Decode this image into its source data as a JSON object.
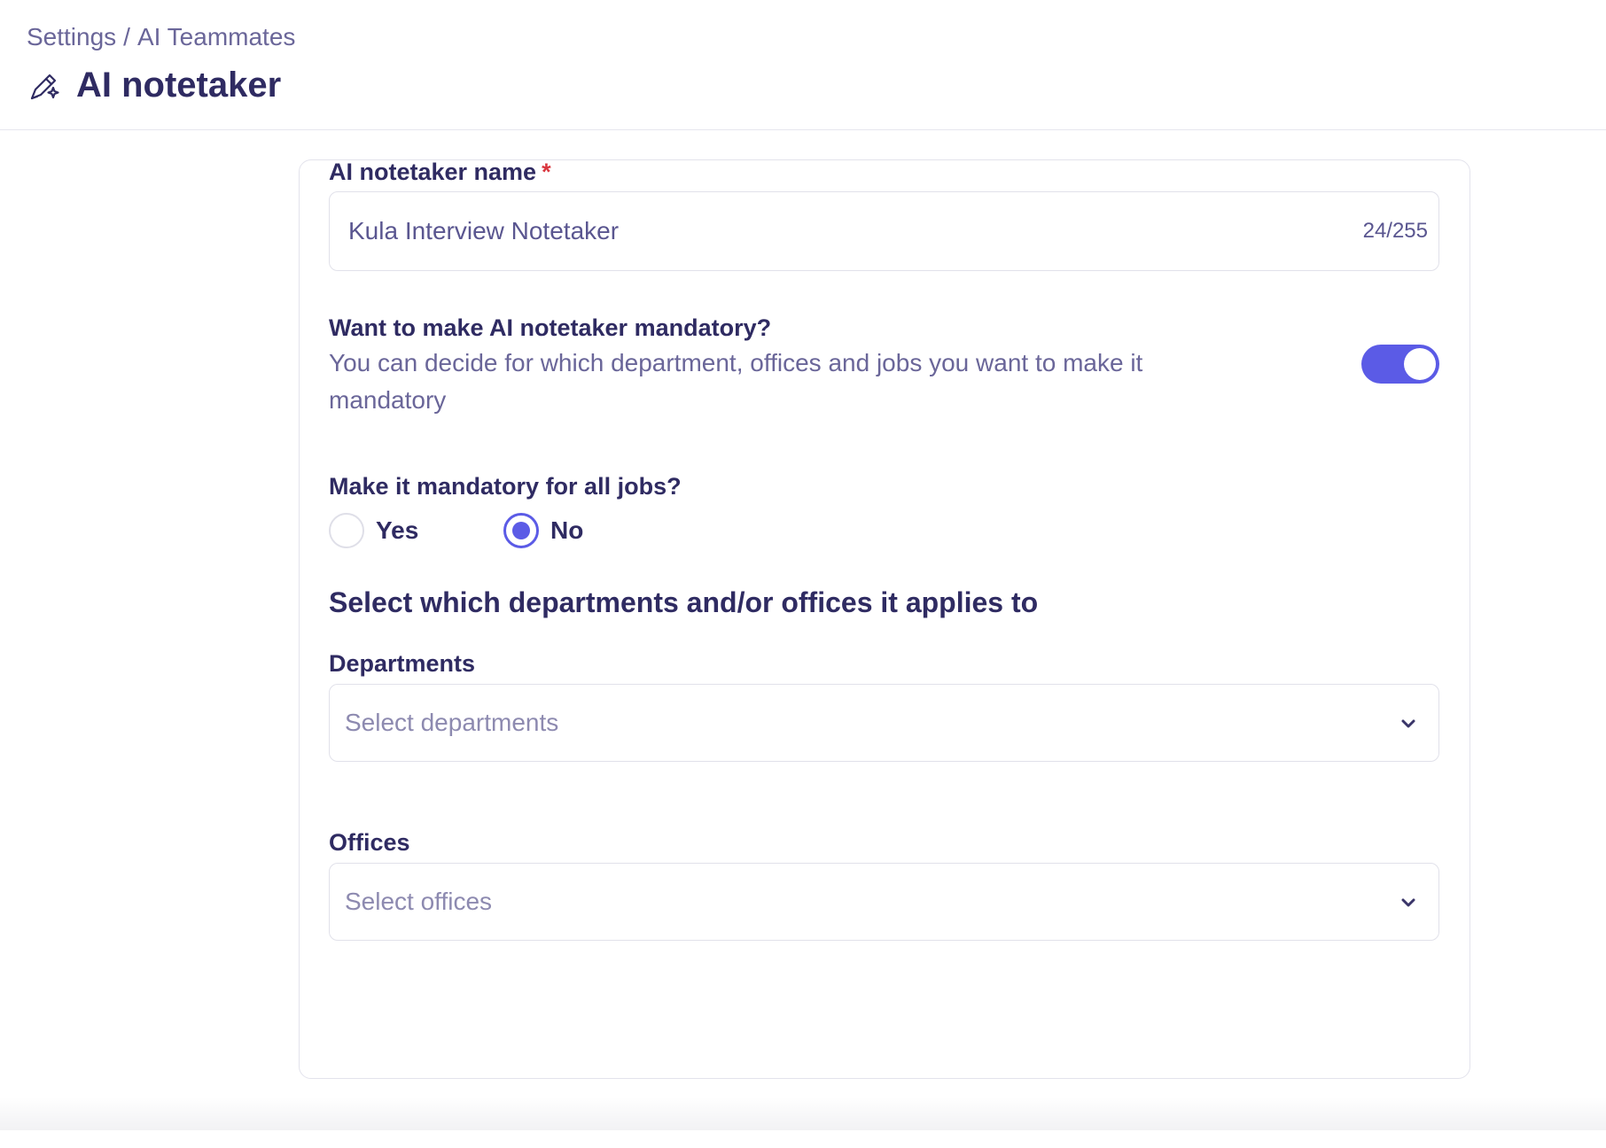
{
  "header": {
    "breadcrumb": [
      "Settings",
      "AI Teammates"
    ],
    "breadcrumb_separator": "/",
    "title": "AI notetaker",
    "title_icon": "pen-sparkle-icon"
  },
  "form": {
    "name_field": {
      "label": "AI notetaker name",
      "required_mark": "*",
      "value": "Kula Interview Notetaker",
      "counter": "24/255"
    },
    "mandatory_toggle": {
      "title": "Want to make AI notetaker mandatory?",
      "description": "You can decide for which department, offices and jobs you want to make it mandatory",
      "enabled": true
    },
    "all_jobs": {
      "title": "Make it mandatory for all jobs?",
      "options": [
        {
          "label": "Yes",
          "selected": false
        },
        {
          "label": "No",
          "selected": true
        }
      ]
    },
    "applies_heading": "Select which departments and/or offices it applies to",
    "departments": {
      "label": "Departments",
      "placeholder": "Select departments"
    },
    "offices": {
      "label": "Offices",
      "placeholder": "Select offices"
    }
  },
  "colors": {
    "accent": "#5b5be6",
    "heading": "#2f2b62",
    "muted_text": "#6a6699",
    "required": "#d9363e"
  }
}
